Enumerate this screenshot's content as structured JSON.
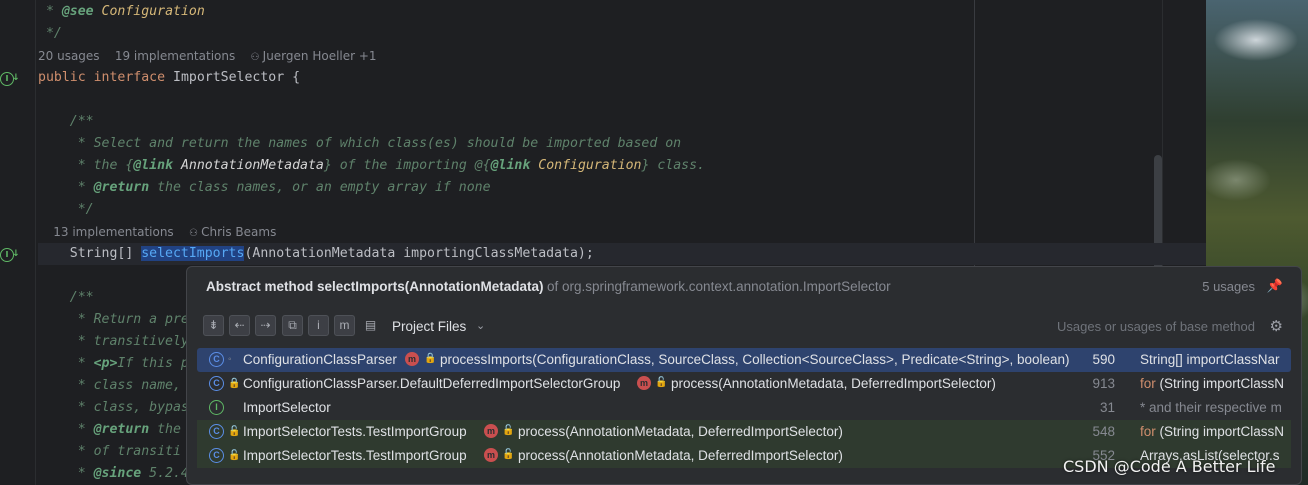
{
  "editor": {
    "line1": {
      "marker": " * ",
      "tag": "@see",
      "ref": "Configuration"
    },
    "line2": " */",
    "hint1": {
      "usages": "20 usages",
      "impls": "19 implementations",
      "author": "Juergen Hoeller +1"
    },
    "decl": {
      "kw1": "public",
      "kw2": "interface",
      "name": "ImportSelector {"
    },
    "doc_open": "    /**",
    "doc1": "     * Select and return the names of which class(es) should be imported based on",
    "doc2": {
      "a": "     * the {",
      "tag": "@link",
      "ref": "AnnotationMetadata",
      "b": "} of the importing @{",
      "tag2": "@link",
      "ref2": "Configuration",
      "c": "} class."
    },
    "doc3": {
      "a": "     * ",
      "tag": "@return",
      "b": " the class names, or an empty array if none"
    },
    "doc_close": "     */",
    "hint2": {
      "impls": "13 implementations",
      "author": "Chris Beams"
    },
    "method": {
      "a": "    String[] ",
      "name": "selectImports",
      "b": "(AnnotationMetadata importingClassMetadata);"
    },
    "doc_open2": "    /**",
    "doc4": "     * Return a pre",
    "doc5": "     * transitively",
    "doc6": {
      "a": "     * ",
      "tag": "<p>",
      "b": "If this p"
    },
    "doc7": "     * class name,",
    "doc8": "     * class, bypas",
    "doc9": {
      "a": "     * ",
      "tag": "@return",
      "b": " the"
    },
    "doc10": "     * of transiti",
    "doc11": {
      "a": "     * ",
      "tag": "@since",
      "b": " 5.2.4"
    }
  },
  "popup": {
    "title": "Abstract method selectImports(AnnotationMetadata)",
    "of": "of org.springframework.context.annotation.ImportSelector",
    "count": "5 usages",
    "scope": "Project Files",
    "filter": "Usages or usages of base method",
    "icons": [
      "collapse-all-icon",
      "navigate-back-icon",
      "navigate-forward-icon",
      "open-in-find-window-icon",
      "info-icon",
      "method-filter-icon",
      "preview-icon",
      "pin-icon",
      "gear-icon"
    ],
    "rows": [
      {
        "cls": "ConfigurationClassParser",
        "method": "processImports(ConfigurationClass, SourceClass, Collection<SourceClass>, Predicate<String>, boolean)",
        "line": "590",
        "snip_kw": "",
        "snip": "String[] importClassNar"
      },
      {
        "cls": "ConfigurationClassParser.DefaultDeferredImportSelectorGroup",
        "method": "process(AnnotationMetadata, DeferredImportSelector)",
        "line": "913",
        "snip_kw": "for",
        "snip": " (String importClassN"
      },
      {
        "cls": "ImportSelector",
        "method": "",
        "line": "31",
        "snip_kw": "",
        "snip": "* and their respective m"
      },
      {
        "cls": "ImportSelectorTests.TestImportGroup",
        "method": "process(AnnotationMetadata, DeferredImportSelector)",
        "line": "548",
        "snip_kw": "for",
        "snip": " (String importClassN"
      },
      {
        "cls": "ImportSelectorTests.TestImportGroup",
        "method": "process(AnnotationMetadata, DeferredImportSelector)",
        "line": "552",
        "snip_kw": "",
        "snip": "Arrays.asList(selector.s"
      }
    ]
  },
  "watermark": "CSDN @Code A Better Life"
}
